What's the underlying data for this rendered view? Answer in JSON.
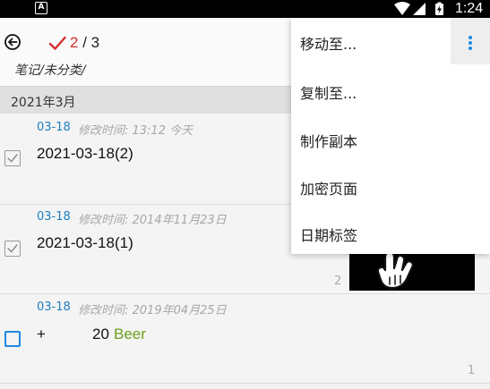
{
  "status_bar": {
    "app_badge": "A",
    "time": "1:24"
  },
  "header": {
    "selected": "2",
    "total": "/ 3",
    "folder_path": "笔记/未分类/"
  },
  "section": {
    "title": "2021年3月"
  },
  "notes": [
    {
      "date": "03-18",
      "modified": "修改时间: 13:12 今天",
      "title": "2021-03-18(2)",
      "checked": true
    },
    {
      "date": "03-18",
      "modified": "修改时间: 2014年11月23日",
      "title": "2021-03-18(1)",
      "checked": true,
      "count": "2"
    },
    {
      "date": "03-18",
      "modified": "修改时间: 2019年04月25日",
      "title_prefix": "+",
      "title_number": "20",
      "title_word": "Beer",
      "checked": false,
      "count": "1"
    }
  ],
  "menu": {
    "items": [
      {
        "label": "移动至..."
      },
      {
        "label": "复制至..."
      },
      {
        "label": "制作副本"
      },
      {
        "label": "加密页面"
      },
      {
        "label": "日期标签"
      }
    ]
  },
  "colors": {
    "accent_blue": "#1e88e5",
    "date_blue": "#1e7fc0",
    "check_red": "#d32f2f",
    "beer_green": "#6a9e1f"
  },
  "icons": {
    "back": "back-circle-arrow-icon",
    "check": "check-mark-icon",
    "more": "more-vertical-icon",
    "hand": "hand-pointer-icon"
  }
}
